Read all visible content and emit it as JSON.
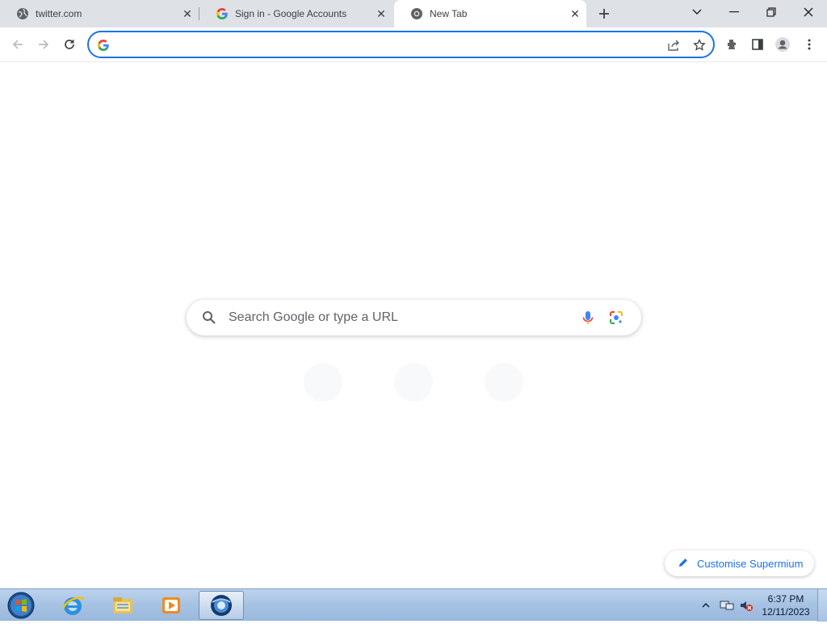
{
  "browser": {
    "tabs": [
      {
        "title": "twitter.com",
        "favicon": "globe-icon",
        "active": false
      },
      {
        "title": "Sign in - Google Accounts",
        "favicon": "google-g-icon",
        "active": false
      },
      {
        "title": "New Tab",
        "favicon": "chromium-icon",
        "active": true
      }
    ],
    "window_controls": [
      "tab-search-icon",
      "minimize-icon",
      "restore-icon",
      "close-icon"
    ],
    "omnibox": {
      "value": "",
      "placeholder": ""
    }
  },
  "ntp": {
    "search_placeholder": "Search Google or type a URL",
    "customise_label": "Customise Supermium"
  },
  "taskbar": {
    "apps": [
      "start-orb-icon",
      "internet-explorer-icon",
      "file-explorer-icon",
      "media-player-icon",
      "supermium-browser-icon"
    ],
    "clock": {
      "time": "6:37 PM",
      "date": "12/11/2023"
    }
  },
  "colors": {
    "accent": "#1a73e8",
    "tabstrip": "#dee1e6",
    "taskbar": "#a6c2e3"
  }
}
